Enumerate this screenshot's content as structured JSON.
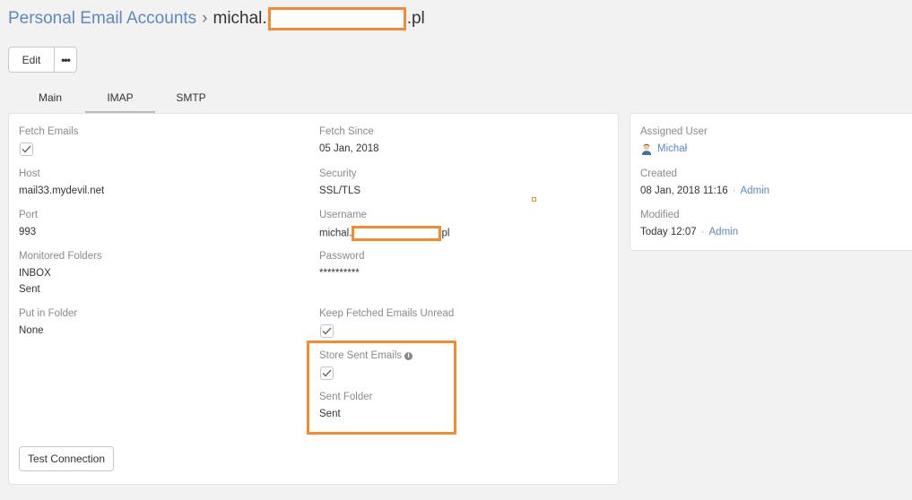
{
  "breadcrumb": {
    "parent": "Personal Email Accounts",
    "separator": "›",
    "current_prefix": "michal.",
    "current_suffix": ".pl"
  },
  "toolbar": {
    "edit_label": "Edit",
    "more_label": "•••"
  },
  "tabs": [
    {
      "label": "Main",
      "active": false
    },
    {
      "label": "IMAP",
      "active": true
    },
    {
      "label": "SMTP",
      "active": false
    }
  ],
  "imap": {
    "fetch_emails": {
      "label": "Fetch Emails",
      "checked": true
    },
    "fetch_since": {
      "label": "Fetch Since",
      "value": "05 Jan, 2018"
    },
    "host": {
      "label": "Host",
      "value": "mail33.mydevil.net"
    },
    "security": {
      "label": "Security",
      "value": "SSL/TLS"
    },
    "port": {
      "label": "Port",
      "value": "993"
    },
    "username": {
      "label": "Username",
      "value_prefix": "michal.",
      "value_suffix": "pl"
    },
    "monitored_folders": {
      "label": "Monitored Folders",
      "values": [
        "INBOX",
        "Sent"
      ]
    },
    "password": {
      "label": "Password",
      "value": "**********"
    },
    "put_in_folder": {
      "label": "Put in Folder",
      "value": "None"
    },
    "keep_unread": {
      "label": "Keep Fetched Emails Unread",
      "checked": true
    },
    "store_sent": {
      "label": "Store Sent Emails",
      "checked": true,
      "info_icon": "info-icon"
    },
    "sent_folder": {
      "label": "Sent Folder",
      "value": "Sent"
    },
    "test_connection_label": "Test Connection"
  },
  "side": {
    "assigned_user": {
      "label": "Assigned User",
      "name": "Michał",
      "avatar_icon": "user-avatar-icon"
    },
    "created": {
      "label": "Created",
      "date": "08 Jan, 2018 11:16",
      "separator": "·",
      "by": "Admin"
    },
    "modified": {
      "label": "Modified",
      "date": "Today 12:07",
      "separator": "·",
      "by": "Admin"
    }
  },
  "colors": {
    "link": "#5a89c2",
    "highlight": "#f58a2e",
    "background": "#f2f2f2"
  }
}
